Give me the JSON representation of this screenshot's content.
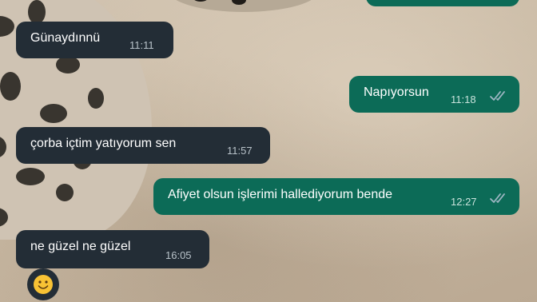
{
  "messages": [
    {
      "direction": "in",
      "text": "Günaydınnü",
      "time": "11:11"
    },
    {
      "direction": "out",
      "text": "Napıyorsun",
      "time": "11:18",
      "status": "read"
    },
    {
      "direction": "in",
      "text": "çorba içtim yatıyorum sen",
      "time": "11:57"
    },
    {
      "direction": "out",
      "text": "Afiyet olsun işlerimi hallediyorum bende",
      "time": "12:27",
      "status": "read"
    },
    {
      "direction": "in",
      "text": "ne güzel ne güzel",
      "time": "16:05"
    }
  ],
  "colors": {
    "incoming_bubble": "#232d36",
    "outgoing_bubble": "#0c6b57",
    "read_ticks": "#9fb7c4"
  },
  "icons": {
    "read_receipt": "double-check-icon",
    "reaction": "smiley-emoji-icon"
  }
}
